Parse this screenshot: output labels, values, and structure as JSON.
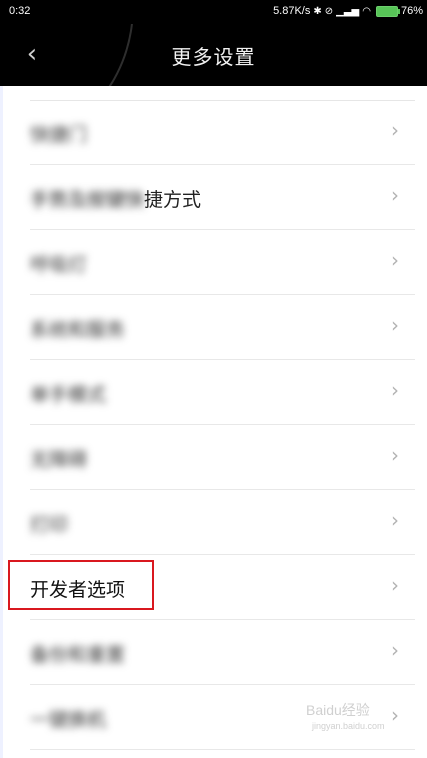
{
  "status_bar": {
    "time": "0:32",
    "net_speed": "5.87K/s",
    "battery": "76%",
    "icons": [
      "bluetooth-icon",
      "silent-icon",
      "signal-icon",
      "wifi-icon",
      "battery-icon"
    ]
  },
  "header": {
    "title": "更多设置",
    "back_icon": "chevron-left-icon"
  },
  "items": [
    {
      "label": "快捷门",
      "blurred": true
    },
    {
      "label": "手势及按键快捷方式",
      "blurred": "partial"
    },
    {
      "label": "呼吸灯",
      "blurred": true
    },
    {
      "label": "系统和服务",
      "blurred": true
    },
    {
      "label": "单手模式",
      "blurred": true
    },
    {
      "label": "无障碍",
      "blurred": true
    },
    {
      "label": "打印",
      "blurred": true
    },
    {
      "label": "开发者选项",
      "blurred": false
    },
    {
      "label": "备份和重置",
      "blurred": true
    },
    {
      "label": "一键换机",
      "blurred": true
    }
  ],
  "watermark": {
    "text": "Baidu经验",
    "sub": "jingyan.baidu.com"
  },
  "colors": {
    "highlight_border": "#d9181f",
    "header_bg": "#000000"
  }
}
